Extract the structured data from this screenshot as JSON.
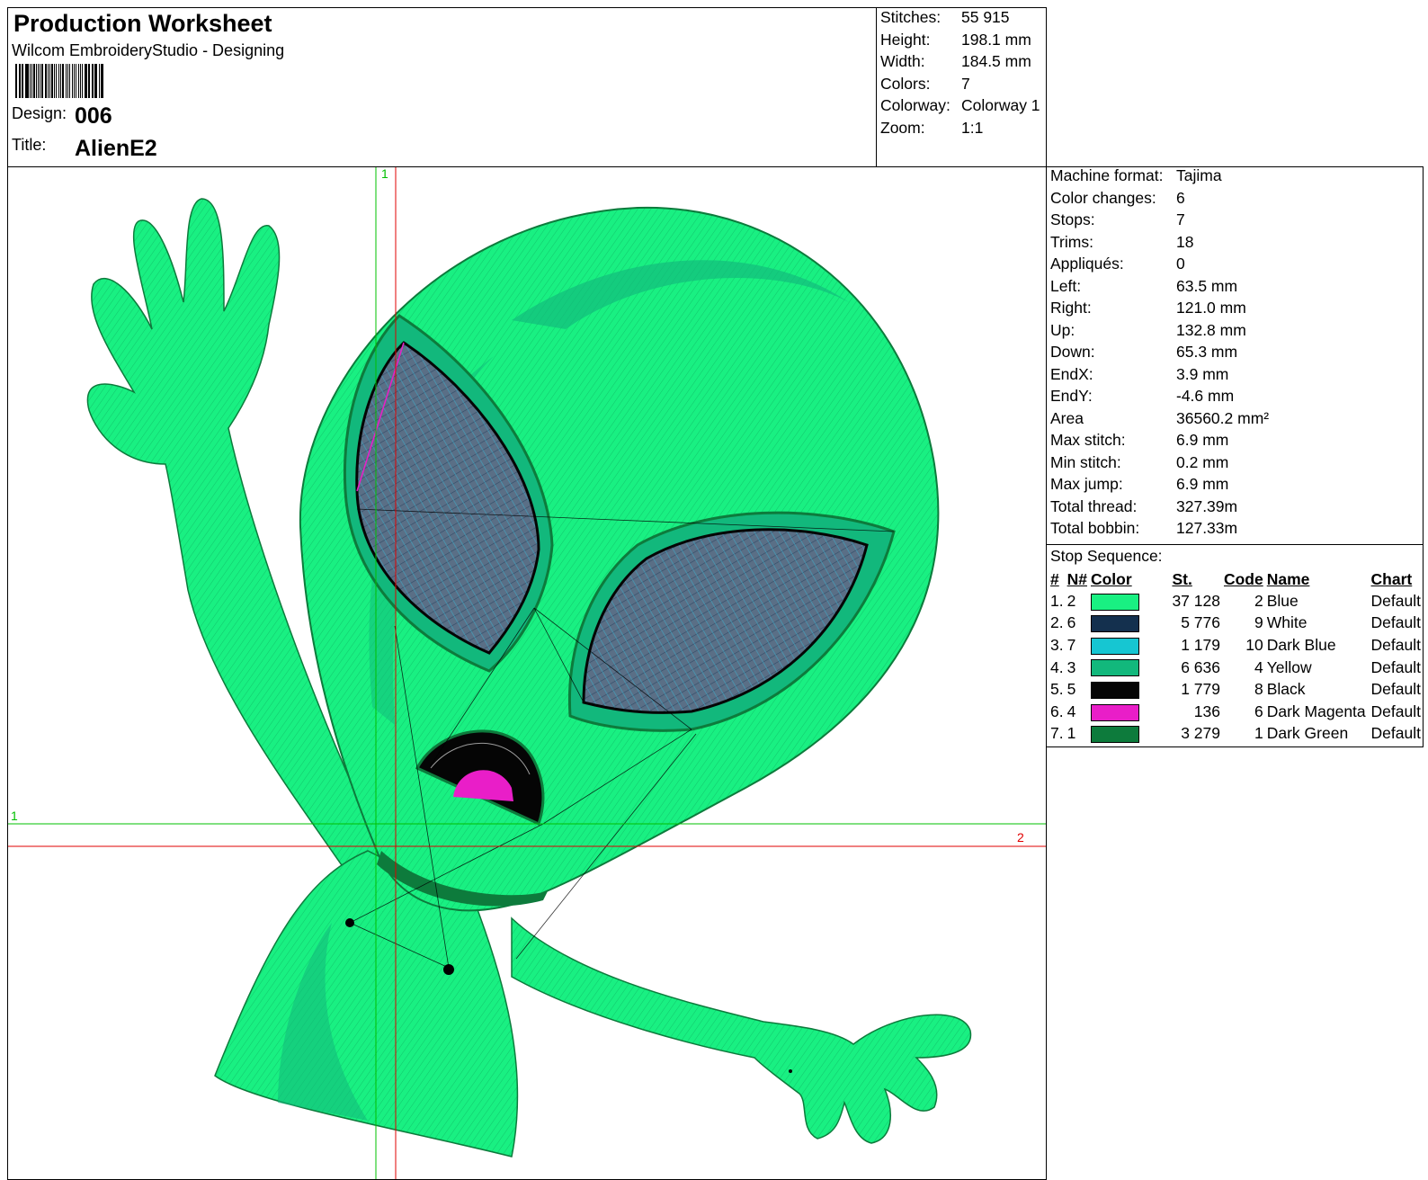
{
  "header": {
    "title": "Production Worksheet",
    "software": "Wilcom EmbroideryStudio - Designing",
    "design_label": "Design:",
    "design_value": "006",
    "title_label": "Title:",
    "title_value": "AlienE2"
  },
  "stats": [
    {
      "k": "Stitches:",
      "v": "55 915"
    },
    {
      "k": "Height:",
      "v": "198.1 mm"
    },
    {
      "k": "Width:",
      "v": "184.5 mm"
    },
    {
      "k": "Colors:",
      "v": "7"
    },
    {
      "k": "Colorway:",
      "v": "Colorway 1"
    },
    {
      "k": "Zoom:",
      "v": "1:1"
    }
  ],
  "machine": [
    {
      "k": "Machine format:",
      "v": "Tajima"
    },
    {
      "k": "Color changes:",
      "v": "6"
    },
    {
      "k": "Stops:",
      "v": "7"
    },
    {
      "k": "Trims:",
      "v": "18"
    },
    {
      "k": "Appliqués:",
      "v": "0"
    },
    {
      "k": "Left:",
      "v": "63.5 mm"
    },
    {
      "k": "Right:",
      "v": "121.0 mm"
    },
    {
      "k": "Up:",
      "v": "132.8 mm"
    },
    {
      "k": "Down:",
      "v": "65.3 mm"
    },
    {
      "k": "EndX:",
      "v": "3.9 mm"
    },
    {
      "k": "EndY:",
      "v": "-4.6 mm"
    },
    {
      "k": "Area",
      "v": "36560.2 mm²"
    },
    {
      "k": "Max stitch:",
      "v": "6.9 mm"
    },
    {
      "k": "Min stitch:",
      "v": "0.2 mm"
    },
    {
      "k": "Max jump:",
      "v": "6.9 mm"
    },
    {
      "k": "Total thread:",
      "v": "327.39m"
    },
    {
      "k": "Total bobbin:",
      "v": "127.33m"
    }
  ],
  "sequence": {
    "heading": "Stop Sequence:",
    "columns": [
      "#",
      "N#",
      "Color",
      "St.",
      "Code",
      "Name",
      "Chart"
    ],
    "rows": [
      {
        "num": "1.",
        "n": "2",
        "color": "#19f082",
        "st": "37 128",
        "code": "2",
        "name": "Blue",
        "chart": "Default"
      },
      {
        "num": "2.",
        "n": "6",
        "color": "#14304e",
        "st": "5 776",
        "code": "9",
        "name": "White",
        "chart": "Default"
      },
      {
        "num": "3.",
        "n": "7",
        "color": "#16c6d2",
        "st": "1 179",
        "code": "10",
        "name": "Dark Blue",
        "chart": "Default"
      },
      {
        "num": "4.",
        "n": "3",
        "color": "#12b87c",
        "st": "6 636",
        "code": "4",
        "name": "Yellow",
        "chart": "Default"
      },
      {
        "num": "5.",
        "n": "5",
        "color": "#050505",
        "st": "1 779",
        "code": "8",
        "name": "Black",
        "chart": "Default"
      },
      {
        "num": "6.",
        "n": "4",
        "color": "#e91ec8",
        "st": "136",
        "code": "6",
        "name": "Dark Magenta",
        "chart": "Default"
      },
      {
        "num": "7.",
        "n": "1",
        "color": "#0d7b3c",
        "st": "3 279",
        "code": "1",
        "name": "Dark Green",
        "chart": "Default"
      }
    ]
  },
  "guides": {
    "green_v": "1",
    "green_h": "1",
    "red_h": "2"
  }
}
